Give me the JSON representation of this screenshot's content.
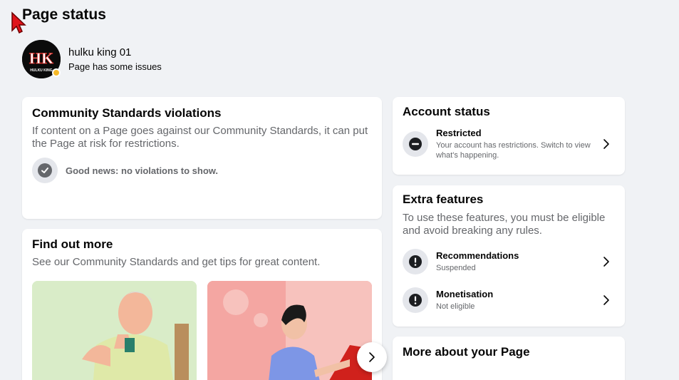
{
  "page_title": "Page status",
  "profile": {
    "name": "hulku king 01",
    "status": "Page has some issues",
    "avatar_letters": "HK",
    "avatar_caption": "HULKU KING"
  },
  "community_standards": {
    "title": "Community Standards violations",
    "description": "If content on a Page goes against our Community Standards, it can put the Page at risk for restrictions.",
    "good_news": "Good news: no violations to show."
  },
  "find_out_more": {
    "title": "Find out more",
    "description": "See our Community Standards and get tips for great content."
  },
  "account_status": {
    "title": "Account status",
    "item_label": "Restricted",
    "item_sub": "Your account has restrictions. Switch to view what's happening."
  },
  "extra_features": {
    "title": "Extra features",
    "description": "To use these features, you must be eligible and avoid breaking any rules.",
    "items": [
      {
        "label": "Recommendations",
        "sub": "Suspended"
      },
      {
        "label": "Monetisation",
        "sub": "Not eligible"
      }
    ]
  },
  "more_about": {
    "title": "More about your Page"
  },
  "colors": {
    "background": "#f0f2f5",
    "warning_badge": "#f7b928",
    "muted_text": "#65676b",
    "icon_bg": "#e4e6eb"
  }
}
